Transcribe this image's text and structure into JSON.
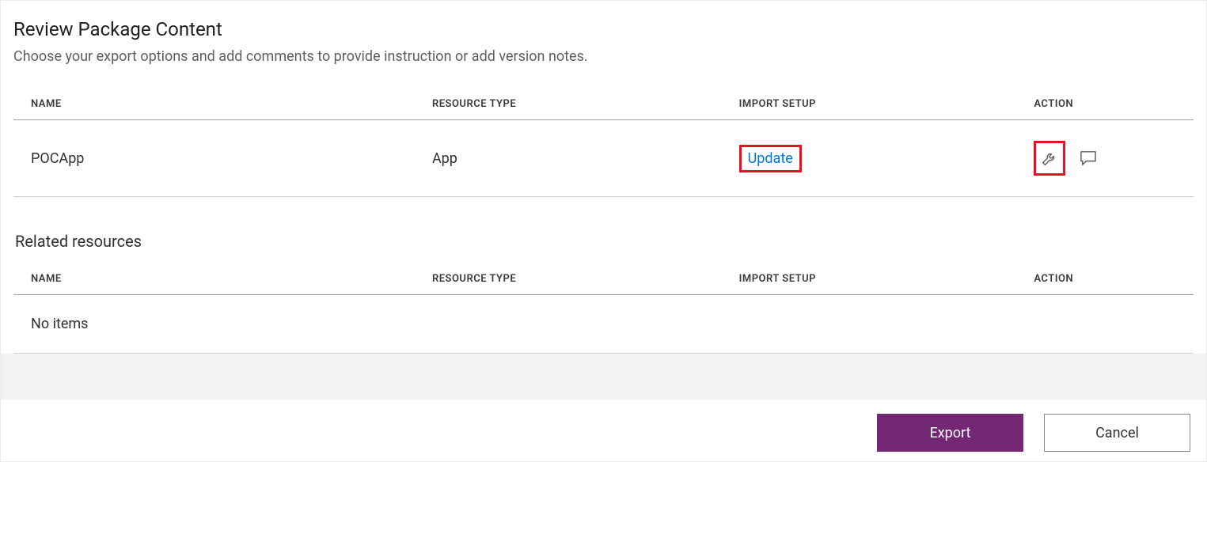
{
  "header": {
    "title": "Review Package Content",
    "subtitle": "Choose your export options and add comments to provide instruction or add version notes."
  },
  "columns": {
    "name": "NAME",
    "resource_type": "RESOURCE TYPE",
    "import_setup": "IMPORT SETUP",
    "action": "ACTION"
  },
  "package_rows": [
    {
      "name": "POCApp",
      "resource_type": "App",
      "import_setup": "Update"
    }
  ],
  "related": {
    "heading": "Related resources",
    "empty_text": "No items"
  },
  "buttons": {
    "export": "Export",
    "cancel": "Cancel"
  }
}
